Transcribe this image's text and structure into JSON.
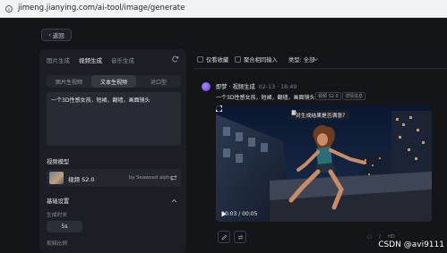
{
  "browser": {
    "url": "jimeng.jianying.com/ai-tool/image/generate"
  },
  "back_label": "返回",
  "left_panel": {
    "tabs": [
      "图片生成",
      "视频生成",
      "音乐生成"
    ],
    "sub_tabs": [
      "图片生视频",
      "文本生视频",
      "对口型"
    ],
    "prompt": "一个3D性感女孩，短裙，翻墙，画面镜头",
    "video_model_label": "视频模型",
    "model": {
      "name": "视频 S2.0",
      "by": "by Seaweed alpha"
    },
    "basic_settings_label": "基础设置",
    "duration_label": "生成时长",
    "duration_value": "5s",
    "ratio_label": "视频比例"
  },
  "filters": {
    "favorites": "仅看收藏",
    "merge": "聚合相同输入",
    "type": "类型: 全部"
  },
  "generation": {
    "title": "即梦 · 视频生成",
    "time": "02-13 · 18:49",
    "prompt": "一个3D性感女孩，短裙，翻墙，画面镜头",
    "tags": [
      "视频 S2.0",
      "详情信息"
    ],
    "feedback_question": "对生成结果是否满意?",
    "time_display": "00:03 / 00:05"
  },
  "bottom": {
    "hd_label": "HD"
  },
  "watermark": "CSDN @avi9111",
  "colors": {
    "background": "#131519",
    "panel": "#1b1e24",
    "accent": "#7b5cff"
  }
}
